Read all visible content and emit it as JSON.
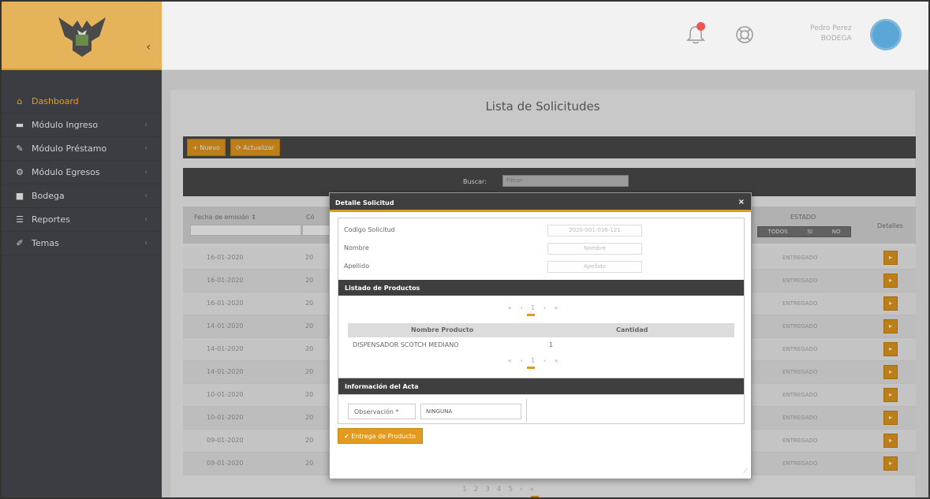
{
  "sidebar": {
    "items": [
      {
        "label": "Dashboard",
        "icon": "home-icon"
      },
      {
        "label": "Módulo Ingreso",
        "icon": "truck-icon"
      },
      {
        "label": "Módulo Préstamo",
        "icon": "pencil-icon"
      },
      {
        "label": "Módulo Egresos",
        "icon": "gear-icon"
      },
      {
        "label": "Bodega",
        "icon": "building-icon"
      },
      {
        "label": "Reportes",
        "icon": "list-icon"
      },
      {
        "label": "Temas",
        "icon": "brush-icon"
      }
    ],
    "collapse_glyph": "‹"
  },
  "topbar": {
    "user_name": "Pedro Perez",
    "user_role": "BODEGA"
  },
  "main": {
    "title": "Lista de Solicitudes",
    "toolbar": {
      "new_label": "Nuevo",
      "refresh_label": "Actualizar"
    },
    "search": {
      "label": "Buscar:",
      "placeholder": "Filtrar"
    },
    "table": {
      "col_fecha": "Fecha de emisión ↕",
      "col_cod": "Có",
      "col_estado": "ESTADO",
      "estado_filters": [
        "TODOS",
        "SI",
        "NO"
      ],
      "col_detalles": "Detalles",
      "rows": [
        {
          "fecha": "16-01-2020",
          "cod": "20",
          "estado": "ENTREGADO"
        },
        {
          "fecha": "16-01-2020",
          "cod": "20",
          "estado": "ENTREGADO"
        },
        {
          "fecha": "16-01-2020",
          "cod": "20",
          "estado": "ENTREGADO"
        },
        {
          "fecha": "14-01-2020",
          "cod": "20",
          "estado": "ENTREGADO"
        },
        {
          "fecha": "14-01-2020",
          "cod": "20",
          "estado": "ENTREGADO"
        },
        {
          "fecha": "14-01-2020",
          "cod": "20",
          "estado": "ENTREGADO"
        },
        {
          "fecha": "10-01-2020",
          "cod": "20",
          "estado": "ENTREGADO"
        },
        {
          "fecha": "10-01-2020",
          "cod": "20",
          "estado": "ENTREGADO"
        },
        {
          "fecha": "09-01-2020",
          "cod": "20",
          "estado": "ENTREGADO"
        },
        {
          "fecha": "09-01-2020",
          "cod": "20",
          "estado": "ENTREGADO"
        }
      ]
    },
    "pager": "1  2  3  4  5  ›  »"
  },
  "modal": {
    "title": "Detalle Solicitud",
    "close": "×",
    "fields": [
      {
        "label": "Codigo Solicitud",
        "value": "2020-001-036-121"
      },
      {
        "label": "Nombre",
        "value": "Nombre"
      },
      {
        "label": "Apellido",
        "value": "Apellido"
      }
    ],
    "productos_title": "Listado de Productos",
    "pager": "« ‹ 1 › »",
    "prod_col_nombre": "Nombre Producto",
    "prod_col_cantidad": "Cantidad",
    "productos": [
      {
        "nombre": "DISPENSADOR SCOTCH MEDIANO",
        "cantidad": "1"
      }
    ],
    "acta_title": "Información del Acta",
    "obs_label": "Observación *",
    "obs_value": "NINGUNA",
    "entrega_label": "Entrega de Producto"
  }
}
